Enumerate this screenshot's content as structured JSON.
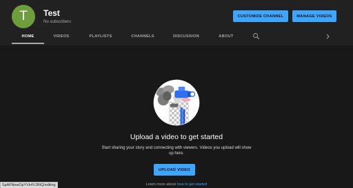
{
  "channel": {
    "avatar_letter": "T",
    "avatar_color": "#6e9e3b",
    "name": "Test",
    "subscribers": "No subscribers"
  },
  "header_buttons": {
    "customize": "CUSTOMIZE CHANNEL",
    "manage": "MANAGE VIDEOS"
  },
  "tabs": [
    {
      "label": "HOME",
      "active": true
    },
    {
      "label": "VIDEOS",
      "active": false
    },
    {
      "label": "PLAYLISTS",
      "active": false
    },
    {
      "label": "CHANNELS",
      "active": false
    },
    {
      "label": "DISCUSSION",
      "active": false
    },
    {
      "label": "ABOUT",
      "active": false
    }
  ],
  "icons": {
    "search": "search-icon",
    "next": "chevron-right-icon"
  },
  "empty_state": {
    "title": "Upload a video to get started",
    "description": "Start sharing your story and connecting with viewers. Videos you upload will show up here.",
    "upload_button": "UPLOAD VIDEO",
    "learn_more_prefix": "Learn more about",
    "learn_more_link": "how to get started"
  },
  "status_url": "SpAFNewOpYVk4VJRtQ/editing",
  "colors": {
    "accent": "#3ea6ff",
    "page_bg": "#181818",
    "header_bg": "#212121"
  }
}
